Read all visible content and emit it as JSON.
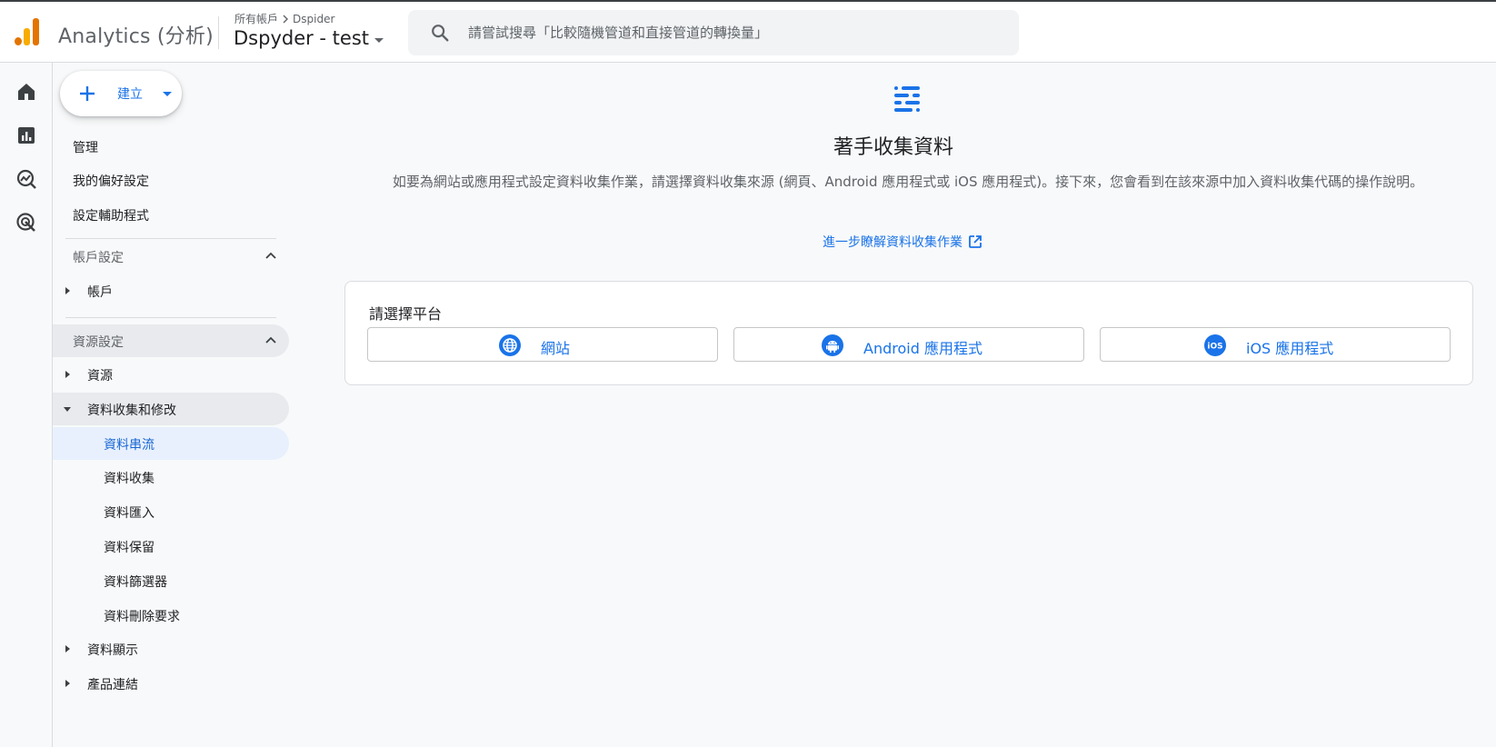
{
  "header": {
    "app_name": "Analytics (分析)",
    "breadcrumb_root": "所有帳戶",
    "breadcrumb_account": "Dspider",
    "property_name": "Dspyder - test",
    "search_placeholder": "請嘗試搜尋「比較隨機管道和直接管道的轉換量」"
  },
  "rail": {
    "items": [
      "home-icon",
      "reports-icon",
      "explore-icon",
      "advertising-icon"
    ]
  },
  "sidebar": {
    "create_label": "建立",
    "top_items": [
      "管理",
      "我的偏好設定",
      "設定輔助程式"
    ],
    "account_section": {
      "title": "帳戶設定",
      "items": [
        "帳戶"
      ]
    },
    "property_section": {
      "title": "資源設定",
      "items": [
        "資源",
        "資料收集和修改"
      ],
      "sub_items": [
        "資料串流",
        "資料收集",
        "資料匯入",
        "資料保留",
        "資料篩選器",
        "資料刪除要求"
      ],
      "more_items": [
        "資料顯示",
        "產品連結"
      ]
    }
  },
  "main": {
    "title": "著手收集資料",
    "description": "如要為網站或應用程式設定資料收集作業，請選擇資料收集來源 (網頁、Android 應用程式或 iOS 應用程式)。接下來，您會看到在該來源中加入資料收集代碼的操作說明。",
    "learn_more": "進一步瞭解資料收集作業",
    "platform_card": {
      "title": "請選擇平台",
      "buttons": [
        "網站",
        "Android 應用程式",
        "iOS 應用程式"
      ]
    }
  },
  "colors": {
    "accent": "#1a73e8",
    "selected_bg": "#e8f0fe",
    "section_bg": "#e8eaed",
    "logo_dark": "#e37400",
    "logo_light": "#f9ab00"
  }
}
